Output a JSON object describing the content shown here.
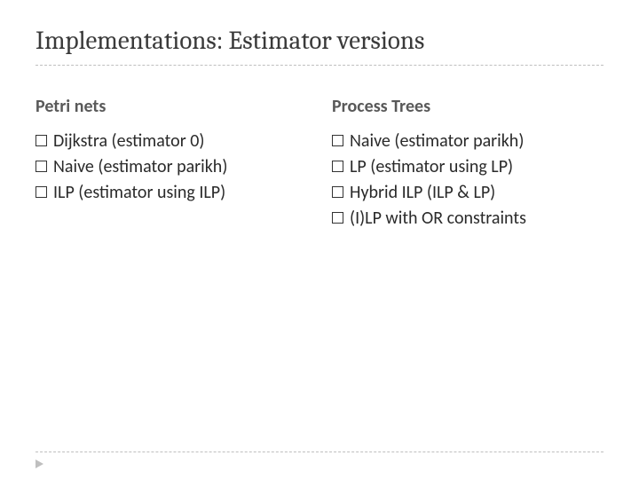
{
  "title": "Implementations: Estimator versions",
  "left": {
    "heading": "Petri nets",
    "items": [
      "Dijkstra (estimator 0)",
      "Naive (estimator parikh)",
      "ILP (estimator using ILP)"
    ]
  },
  "right": {
    "heading": "Process Trees",
    "items": [
      "Naive (estimator parikh)",
      "LP (estimator using LP)",
      "Hybrid ILP (ILP & LP)",
      "(I)LP with OR constraints"
    ]
  }
}
